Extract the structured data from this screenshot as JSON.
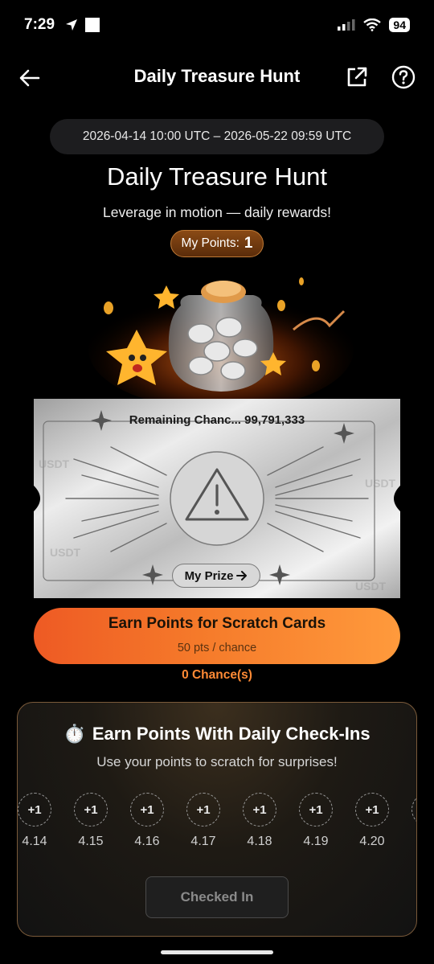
{
  "status_bar": {
    "time": "7:29",
    "battery": "94",
    "icons": [
      "location-arrow-icon",
      "app-square-icon",
      "signal-icon",
      "wifi-icon",
      "battery-icon"
    ]
  },
  "header": {
    "title": "Daily Treasure Hunt",
    "icons": [
      "back-arrow-icon",
      "share-icon",
      "help-icon"
    ]
  },
  "event": {
    "date_range": "2026-04-14 10:00 UTC – 2026-05-22 09:59 UTC",
    "title": "Daily Treasure Hunt",
    "subtitle": "Leverage in motion — daily rewards!",
    "points_label": "My Points:",
    "points_value": "1"
  },
  "scratch_card": {
    "remaining_label": "Remaining Chanc...",
    "remaining_value": "99,791,333",
    "prize_button": "My Prize",
    "center_icon": "warning-icon",
    "watermark": "USDT"
  },
  "earn": {
    "title": "Earn Points for Scratch Cards",
    "subtitle": "50 pts / chance",
    "chances": "0 Chance(s)"
  },
  "checkin": {
    "emoji": "⏱️",
    "title": "Earn Points With Daily Check-Ins",
    "subtitle": "Use your points to scratch for surprises!",
    "days": [
      {
        "reward": "+1",
        "date": "4.14"
      },
      {
        "reward": "+1",
        "date": "4.15"
      },
      {
        "reward": "+1",
        "date": "4.16"
      },
      {
        "reward": "+1",
        "date": "4.17"
      },
      {
        "reward": "+1",
        "date": "4.18"
      },
      {
        "reward": "+1",
        "date": "4.19"
      },
      {
        "reward": "+1",
        "date": "4.20"
      }
    ],
    "button": "Checked In"
  },
  "colors": {
    "accent_orange": "#ff8a35",
    "button_gradient_start": "#ee5a24",
    "button_gradient_end": "#ff9a3c",
    "points_pill": "#8a4a15"
  }
}
